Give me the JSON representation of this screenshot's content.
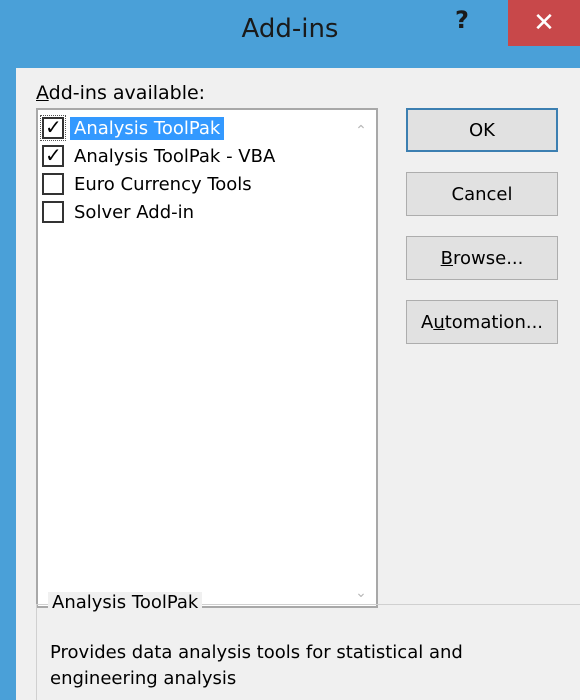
{
  "window": {
    "title": "Add-ins",
    "help_label": "?",
    "close_label": "✕"
  },
  "addins": {
    "label_prefix": "A",
    "label_rest": "dd-ins available:",
    "items": [
      {
        "label": "Analysis ToolPak",
        "checked": true,
        "selected": true
      },
      {
        "label": "Analysis ToolPak - VBA",
        "checked": true,
        "selected": false
      },
      {
        "label": "Euro Currency Tools",
        "checked": false,
        "selected": false
      },
      {
        "label": "Solver Add-in",
        "checked": false,
        "selected": false
      }
    ],
    "scroll_up": "⌃",
    "scroll_down": "⌄",
    "check_glyph": "✓"
  },
  "buttons": {
    "ok": "OK",
    "cancel": "Cancel",
    "browse_prefix": "B",
    "browse_rest": "rowse...",
    "automation_prefix": "A",
    "automation_u": "u",
    "automation_rest": "tomation..."
  },
  "description": {
    "title": "Analysis ToolPak",
    "text": "Provides data analysis tools for statistical and engineering analysis"
  }
}
